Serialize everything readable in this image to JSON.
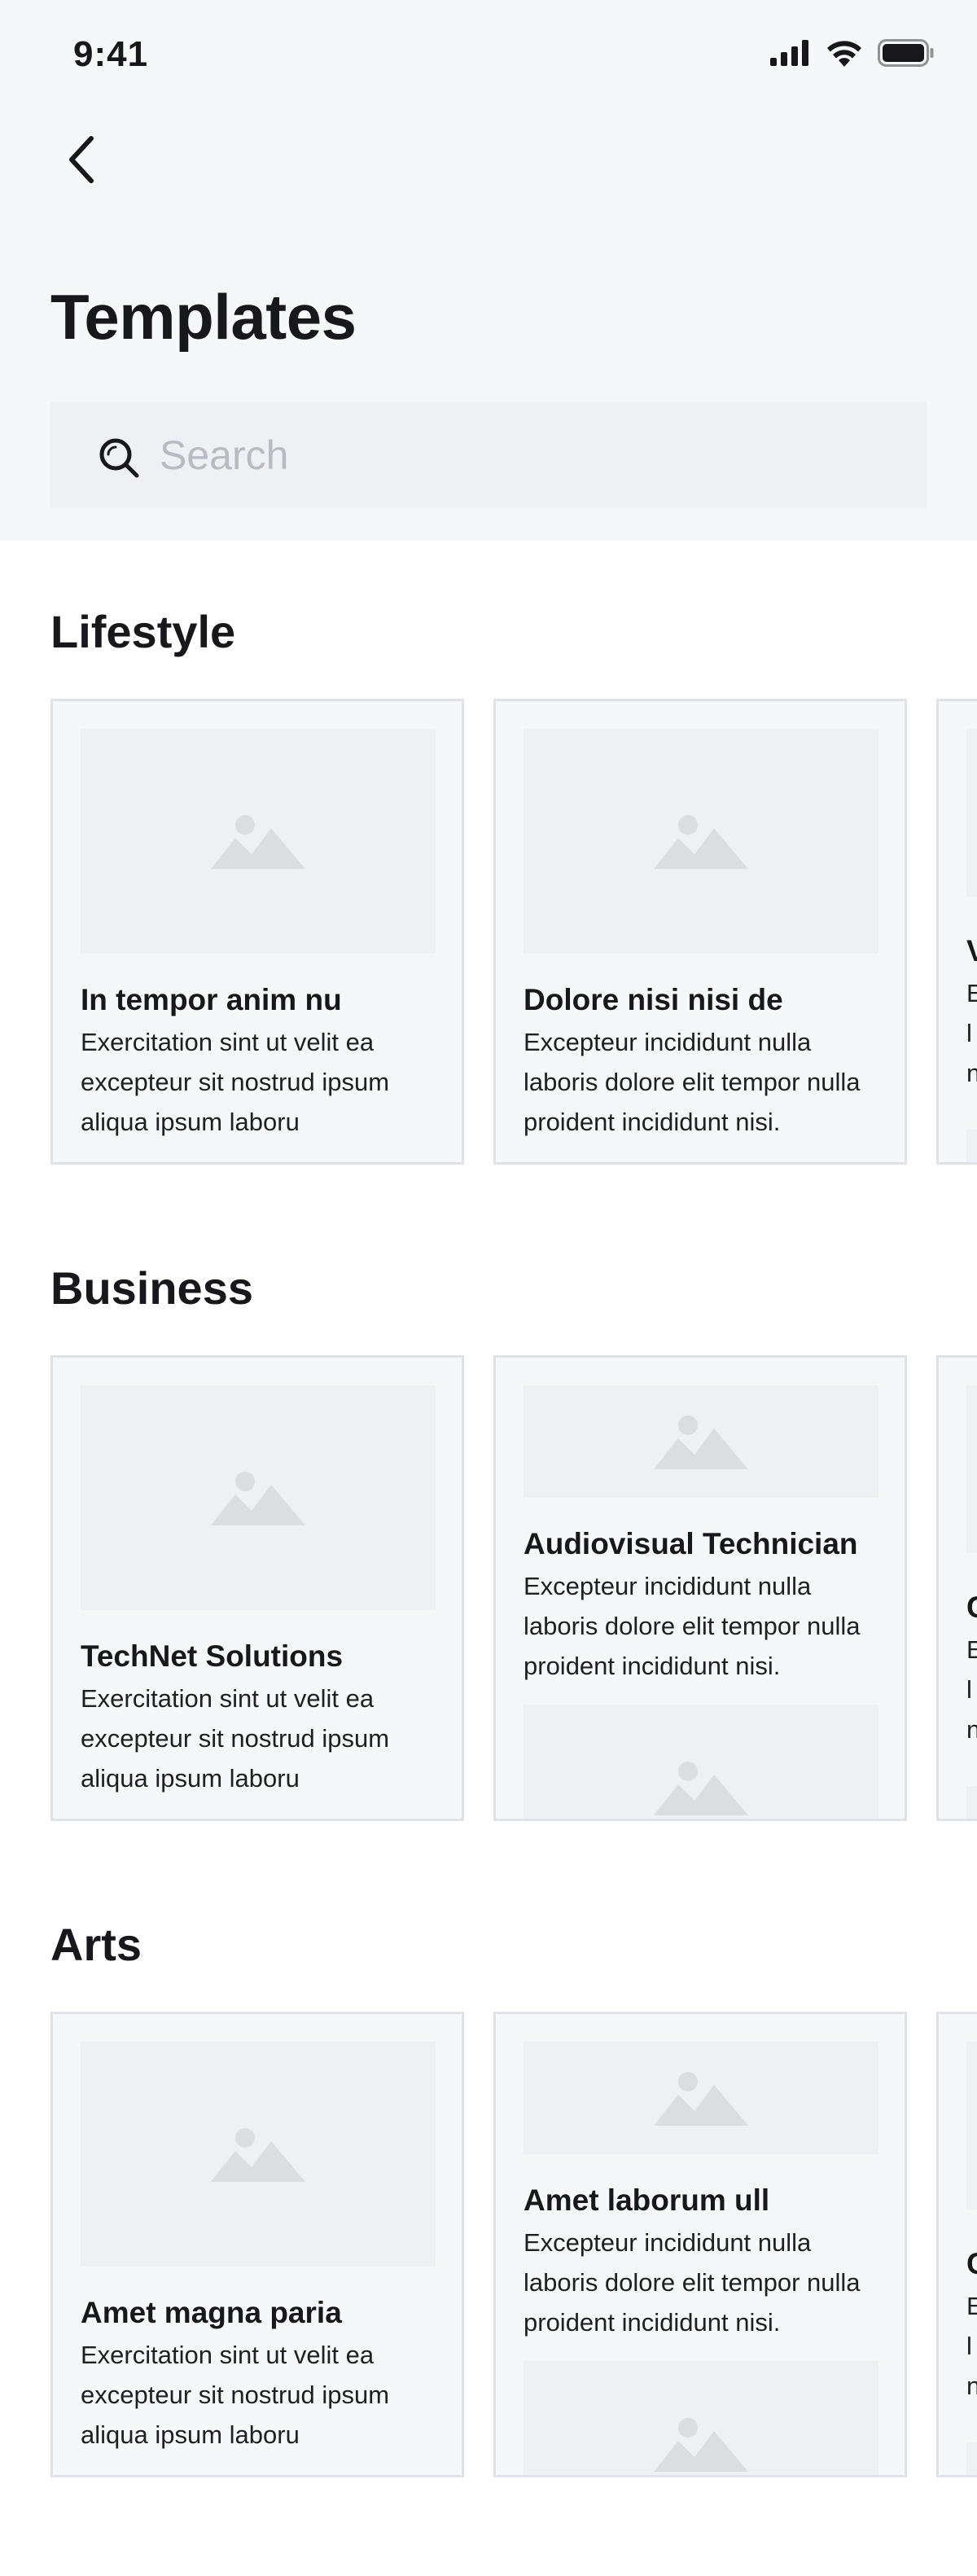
{
  "status_bar": {
    "time": "9:41"
  },
  "header": {
    "title": "Templates"
  },
  "search": {
    "placeholder": "Search"
  },
  "sections": [
    {
      "title": "Lifestyle",
      "cards": [
        {
          "title": "In tempor anim nu",
          "description": "Exercitation sint ut velit ea excepteur sit nostrud ipsum aliqua ipsum laboru"
        },
        {
          "title": "Dolore nisi nisi de",
          "description": "Excepteur incididunt nulla laboris dolore elit tempor nulla proident incididunt nisi."
        },
        {
          "title": "V",
          "description": "E l n"
        }
      ]
    },
    {
      "title": "Business",
      "cards": [
        {
          "title": "TechNet Solutions",
          "description": "Exercitation sint ut velit ea excepteur sit nostrud ipsum aliqua ipsum laboru"
        },
        {
          "title": "Audiovisual Technician",
          "description": "Excepteur incididunt nulla laboris dolore elit tempor nulla proident incididunt nisi."
        },
        {
          "title": "C",
          "description": "E l n"
        }
      ]
    },
    {
      "title": "Arts",
      "cards": [
        {
          "title": "Amet magna paria",
          "description": "Exercitation sint ut velit ea excepteur sit nostrud ipsum aliqua ipsum laboru"
        },
        {
          "title": "Amet laborum ull",
          "description": "Excepteur incididunt nulla laboris dolore elit tempor nulla proident incididunt nisi."
        },
        {
          "title": "C",
          "description": "E l n"
        }
      ]
    }
  ],
  "colors": {
    "header_bg": "#f6f7f9",
    "card_bg": "#f6f7f9",
    "placeholder_bg": "#eff0f3",
    "placeholder_icon": "#dcdde1",
    "text": "#17171c"
  }
}
